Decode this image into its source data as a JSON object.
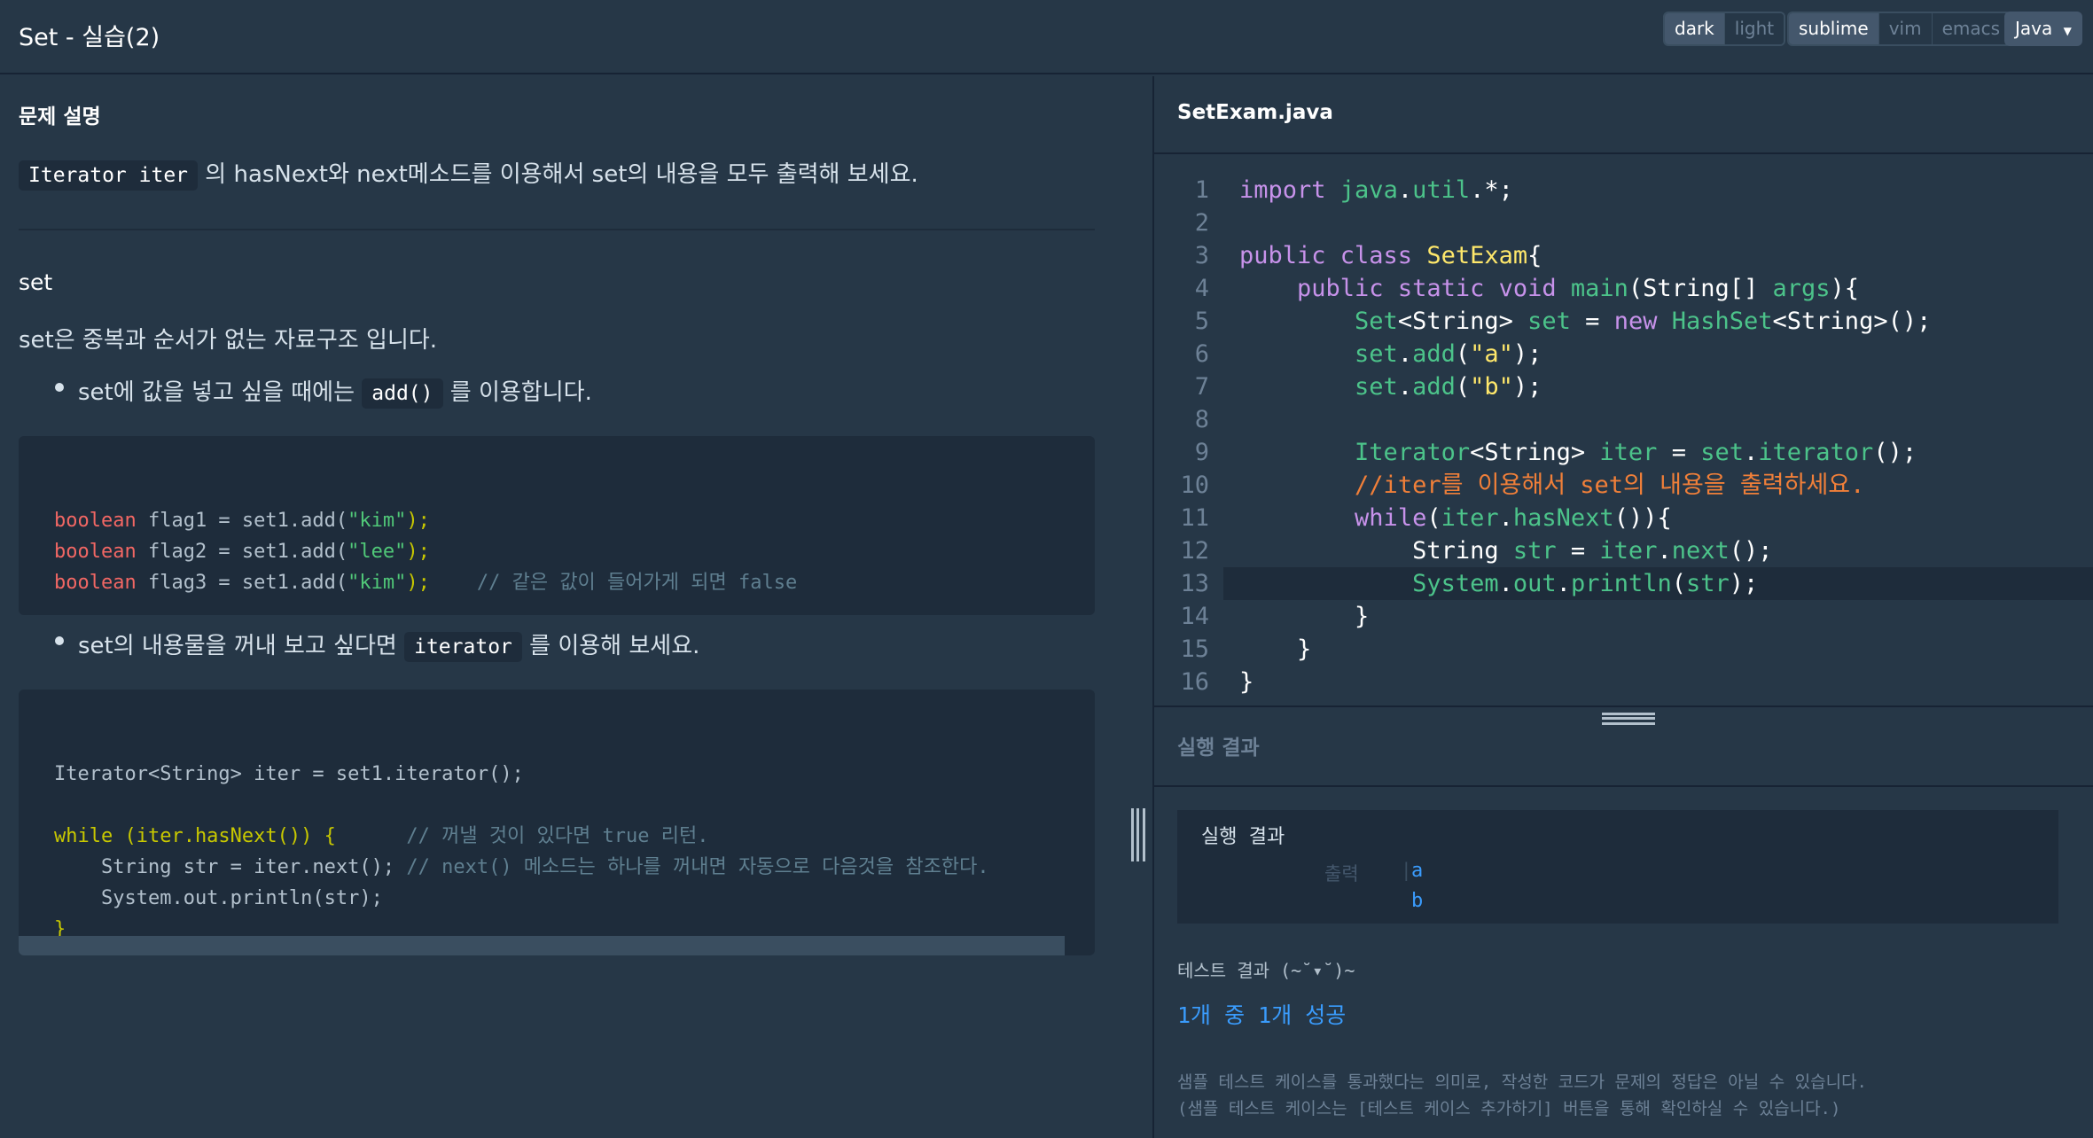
{
  "header": {
    "title": "Set - 실습(2)",
    "theme_options": [
      "dark",
      "light"
    ],
    "theme_selected": "dark",
    "keymap_options": [
      "sublime",
      "vim",
      "emacs"
    ],
    "keymap_selected": "sublime",
    "language": "Java"
  },
  "problem": {
    "section_title": "문제 설명",
    "intro_code": "Iterator iter",
    "intro_text": "의 hasNext와 next메소드를 이용해서 set의 내용을 모두 출력해 보세요.",
    "set_title": "set",
    "set_desc": "set은 중복과 순서가 없는 자료구조 입니다.",
    "bullet1_pre": "set에 값을 넣고 싶을 때에는",
    "bullet1_code": "add()",
    "bullet1_post": "를 이용합니다.",
    "bullet2_pre": "set의 내용물을 꺼내 보고 싶다면",
    "bullet2_code": "iterator",
    "bullet2_post": "를 이용해 보세요.",
    "code1": [
      {
        "kw": "boolean",
        "rest": " flag1 = set1.add(",
        "str": "\"kim\"",
        "end": ");",
        "cmt": ""
      },
      {
        "kw": "boolean",
        "rest": " flag2 = set1.add(",
        "str": "\"lee\"",
        "end": ");",
        "cmt": ""
      },
      {
        "kw": "boolean",
        "rest": " flag3 = set1.add(",
        "str": "\"kim\"",
        "end": ");",
        "cmt": "    // 같은 값이 들어가게 되면 false"
      }
    ],
    "code2": [
      "Iterator<String> iter = set1.iterator();",
      "",
      "while (iter.hasNext()) {      // 꺼낼 것이 있다면 true 리턴.",
      "    String str = iter.next(); // next() 메소드는 하나를 꺼내면 자동으로 다음것을 참조한다.",
      "    System.out.println(str);",
      "}"
    ]
  },
  "editor": {
    "filename": "SetExam.java",
    "line_numbers": [
      "1",
      "2",
      "3",
      "4",
      "5",
      "6",
      "7",
      "8",
      "9",
      "10",
      "11",
      "12",
      "13",
      "14",
      "15",
      "16"
    ],
    "active_line": 13
  },
  "result": {
    "panel_label": "실행 결과",
    "box_title": "실행 결과",
    "output_label": "출력",
    "output_values": [
      "a",
      "b"
    ],
    "test_title": "테스트 결과 (~˘▾˘)~",
    "test_summary": "1개 중 1개 성공",
    "note_lines": [
      "샘플 테스트 케이스를 통과했다는 의미로, 작성한 코드가 문제의 정답은 아닐 수 있습니다.",
      "(샘플 테스트 케이스는 [테스트 케이스 추가하기] 버튼을 통해 확인하실 수 있습니다.)"
    ]
  }
}
